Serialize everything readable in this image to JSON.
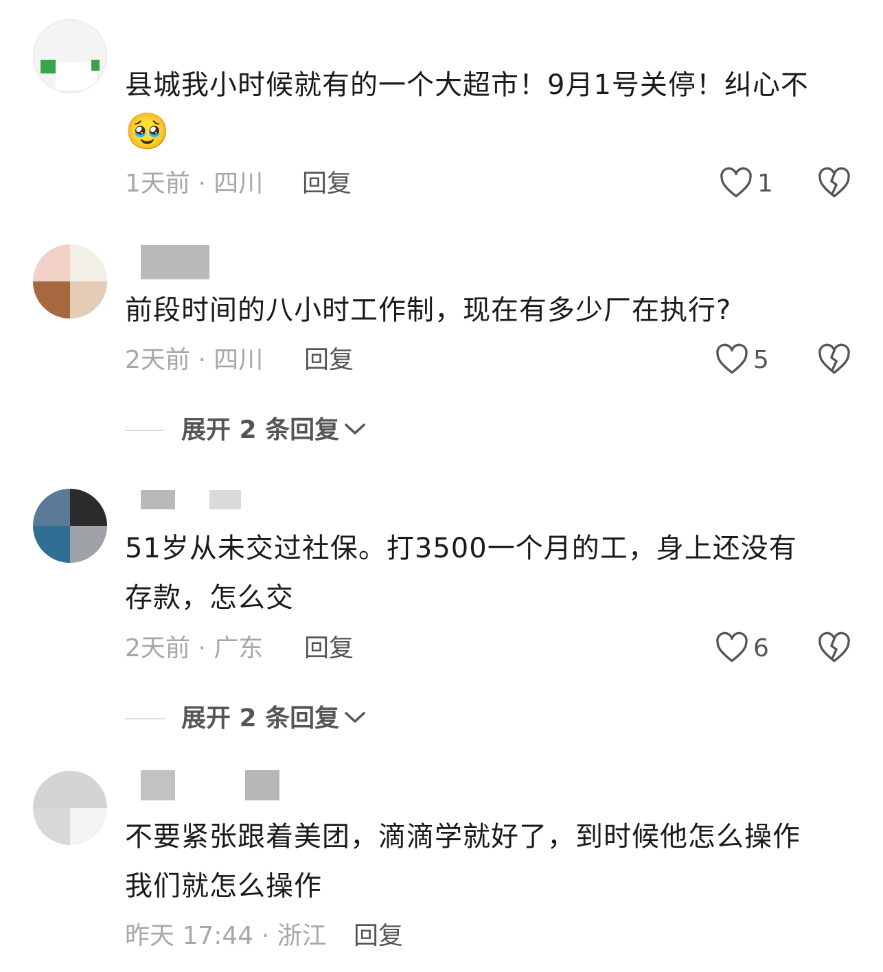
{
  "comments": [
    {
      "text": "县城我小时候就有的一个大超市！9月1号关停！纠心不",
      "emoji": "🥹",
      "time": "1天前",
      "location": "四川",
      "reply_label": "回复",
      "likes": "1"
    },
    {
      "text": "前段时间的八小时工作制，现在有多少厂在执行?",
      "time": "2天前",
      "location": "四川",
      "reply_label": "回复",
      "likes": "5",
      "expand_label": "展开 2 条回复"
    },
    {
      "text_line1": "51岁从未交过社保。打3500一个月的工，身上还没有",
      "text_line2": "存款，怎么交",
      "time": "2天前",
      "location": "广东",
      "reply_label": "回复",
      "likes": "6",
      "expand_label": "展开 2 条回复"
    },
    {
      "text_line1": "不要紧张跟着美团，滴滴学就好了，到时候他怎么操作",
      "text_line2": "我们就怎么操作",
      "time": "昨天 17:44",
      "location": "浙江",
      "reply_label": "回复"
    }
  ],
  "meta_separator": "·",
  "icons": {
    "like": "heart-outline-icon",
    "dislike": "broken-heart-icon",
    "expand": "chevron-down-icon"
  },
  "colors": {
    "text": "#1a1a1a",
    "meta": "#a7a7a7",
    "action": "#555555"
  }
}
